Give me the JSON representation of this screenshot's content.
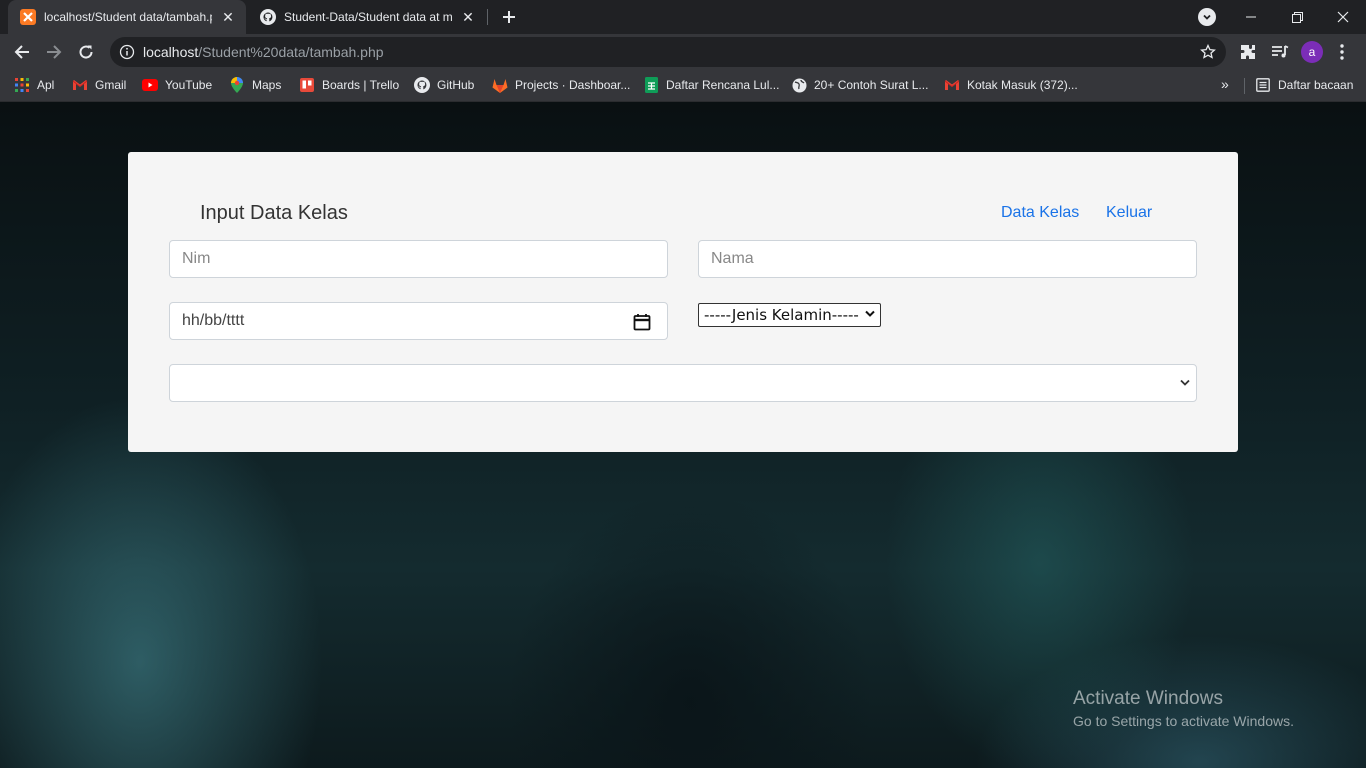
{
  "browser": {
    "tabs": [
      {
        "title": "localhost/Student data/tambah.php",
        "favicon": "xampp-icon",
        "active": true
      },
      {
        "title": "Student-Data/Student data at main",
        "favicon": "github-icon",
        "active": false
      }
    ],
    "url_host": "localhost",
    "url_path": "/Student%20data/tambah.php",
    "avatar_letter": "a",
    "bookmarks": [
      {
        "label": "Apl",
        "icon": "apps-grid-icon"
      },
      {
        "label": "Gmail",
        "icon": "gmail-icon"
      },
      {
        "label": "YouTube",
        "icon": "youtube-icon"
      },
      {
        "label": "Maps",
        "icon": "maps-icon"
      },
      {
        "label": "Boards | Trello",
        "icon": "trello-icon"
      },
      {
        "label": "GitHub",
        "icon": "github-icon"
      },
      {
        "label": "Projects · Dashboar...",
        "icon": "gitlab-icon"
      },
      {
        "label": "Daftar Rencana Lul...",
        "icon": "sheets-icon"
      },
      {
        "label": "20+ Contoh Surat L...",
        "icon": "globe-icon"
      },
      {
        "label": "Kotak Masuk (372)...",
        "icon": "gmail-icon"
      }
    ],
    "reading_list": "Daftar bacaan"
  },
  "form": {
    "title": "Input Data Kelas",
    "links": {
      "data_kelas": "Data Kelas",
      "keluar": "Keluar"
    },
    "nim_placeholder": "Nim",
    "nama_placeholder": "Nama",
    "date_placeholder": "hh/bb/tttt",
    "gender_select": "-----Jenis Kelamin-----",
    "class_select": ""
  },
  "watermark": {
    "line1": "Activate Windows",
    "line2": "Go to Settings to activate Windows."
  },
  "colors": {
    "link": "#1a73e8",
    "card_bg": "#f5f5f5",
    "chrome_dark": "#202124",
    "chrome_toolbar": "#35363a"
  }
}
